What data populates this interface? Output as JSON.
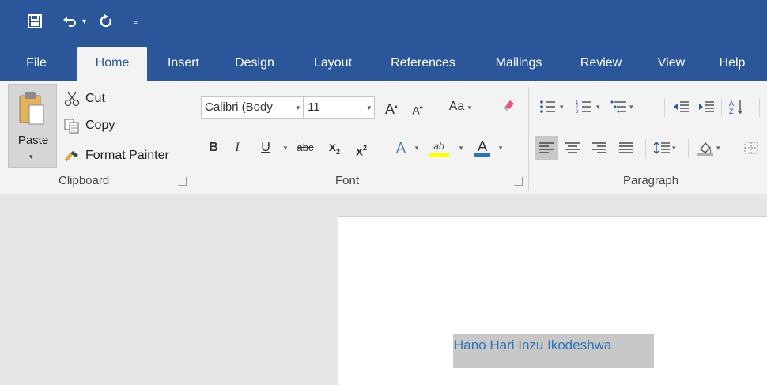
{
  "qat": {
    "save_icon": "save-icon",
    "undo_icon": "undo-icon",
    "redo_icon": "redo-icon",
    "customize_icon": "customize-qat-icon"
  },
  "tabs": [
    {
      "label": "File"
    },
    {
      "label": "Home"
    },
    {
      "label": "Insert"
    },
    {
      "label": "Design"
    },
    {
      "label": "Layout"
    },
    {
      "label": "References"
    },
    {
      "label": "Mailings"
    },
    {
      "label": "Review"
    },
    {
      "label": "View"
    },
    {
      "label": "Help"
    }
  ],
  "active_tab": "Home",
  "clipboard": {
    "paste_label": "Paste",
    "cut_label": "Cut",
    "copy_label": "Copy",
    "format_painter_label": "Format Painter",
    "group_label": "Clipboard"
  },
  "font": {
    "font_name": "Calibri (Body",
    "font_size": "11",
    "grow_label": "A",
    "shrink_label": "A",
    "change_case_label": "Aa",
    "bold": "B",
    "italic": "I",
    "underline": "U",
    "strikethrough": "abc",
    "subscript": "x",
    "superscript": "x",
    "sub_mark": "2",
    "sup_mark": "2",
    "text_effects": "A",
    "highlight": "ab",
    "font_color": "A",
    "group_label": "Font"
  },
  "paragraph": {
    "group_label": "Paragraph",
    "sort_label": "A"
  },
  "document": {
    "text": "Hano Hari Inzu Ikodeshwa"
  },
  "colors": {
    "brand": "#2b579a",
    "ribbon": "#f3f3f3",
    "highlight": "#ffff00",
    "font_color": "#2e74b5"
  }
}
